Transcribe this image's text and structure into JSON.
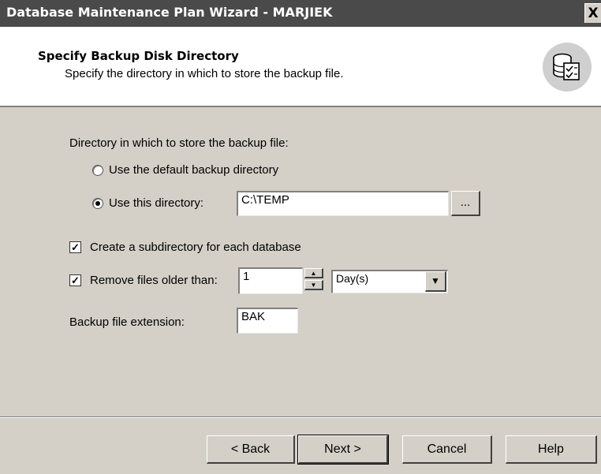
{
  "window": {
    "title": "Database Maintenance Plan Wizard - MARJIEK",
    "close_glyph": "X"
  },
  "header": {
    "title": "Specify Backup Disk Directory",
    "subtitle": "Specify the directory in which to store the backup file.",
    "icon": "database-checklist-icon"
  },
  "form": {
    "directory_group_label": "Directory in which to store the backup file:",
    "use_default": {
      "label": "Use the default backup directory",
      "checked": false
    },
    "use_this": {
      "label": "Use this directory:",
      "checked": true
    },
    "directory_value": "C:\\TEMP",
    "browse_label": "...",
    "create_subdir": {
      "label": "Create a subdirectory for each database",
      "checked": true
    },
    "remove_files": {
      "label": "Remove files older than:",
      "checked": true
    },
    "remove_value": "1",
    "unit_selected": "Day(s)",
    "extension_label": "Backup file extension:",
    "extension_value": "BAK"
  },
  "buttons": {
    "back": "< Back",
    "next": "Next >",
    "cancel": "Cancel",
    "help": "Help"
  }
}
